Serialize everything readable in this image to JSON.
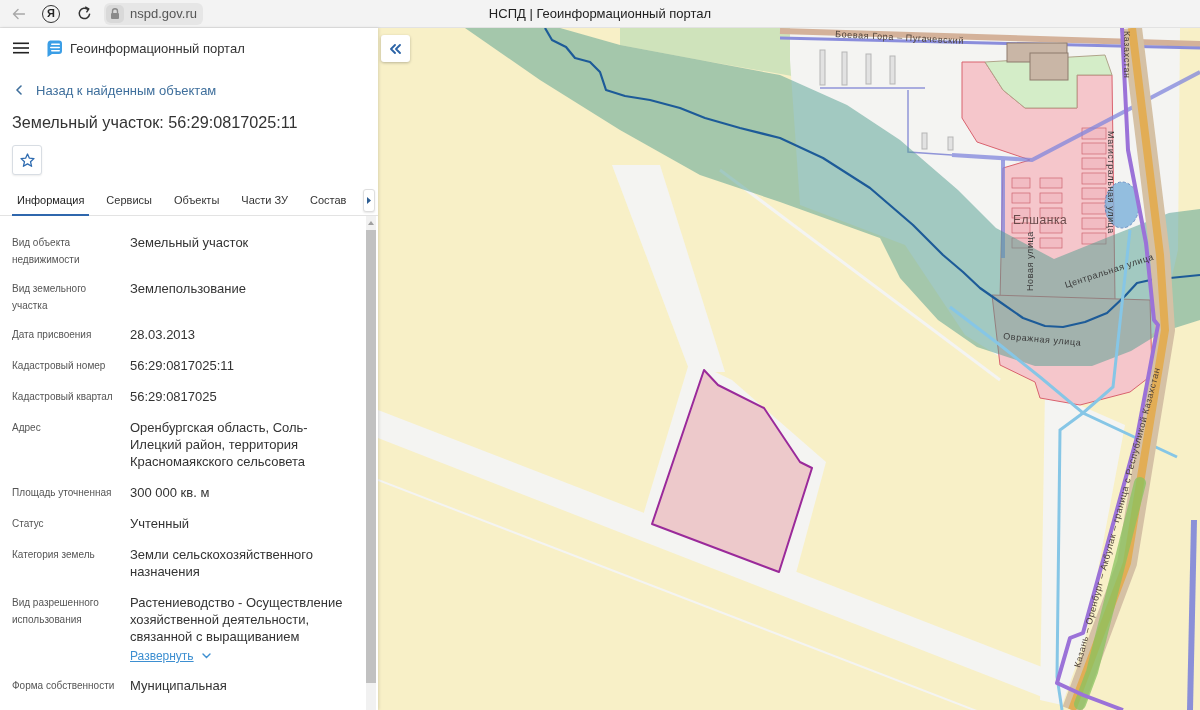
{
  "browser": {
    "brand_glyph": "Я",
    "url": "nspd.gov.ru",
    "page_title": "НСПД | Геоинформационный портал"
  },
  "app_header": {
    "title": "Геоинформационный портал"
  },
  "back_link": "Назад к найденным объектам",
  "object_title": "Земельный участок: 56:29:0817025:11",
  "tabs": [
    {
      "label": "Информация",
      "selected": true
    },
    {
      "label": "Сервисы",
      "selected": false
    },
    {
      "label": "Объекты",
      "selected": false
    },
    {
      "label": "Части ЗУ",
      "selected": false
    },
    {
      "label": "Состав",
      "selected": false
    }
  ],
  "details": [
    {
      "label": "Вид объекта недвижимости",
      "value": "Земельный участок"
    },
    {
      "label": "Вид земельного участка",
      "value": "Землепользование"
    },
    {
      "label": "Дата присвоения",
      "value": "28.03.2013"
    },
    {
      "label": "Кадастровый номер",
      "value": "56:29:0817025:11"
    },
    {
      "label": "Кадастровый квартал",
      "value": "56:29:0817025"
    },
    {
      "label": "Адрес",
      "value": "Оренбургская область, Соль-Илецкий район, территория Красномаякского сельсовета"
    },
    {
      "label": "Площадь уточненная",
      "value": "300 000 кв. м"
    },
    {
      "label": "Статус",
      "value": "Учтенный"
    },
    {
      "label": "Категория земель",
      "value": "Земли сельскохозяйственного назначения"
    },
    {
      "label": "Вид разрешенного использования",
      "value": "Растениеводство - Осуществление хозяйственной деятельности, связанной с выращиванием",
      "expand_link": "Развернуть"
    },
    {
      "label": "Форма собственности",
      "value": "Муниципальная"
    }
  ],
  "map": {
    "labels": [
      {
        "text": "Боевая Гора – Пугачевский",
        "kind": "road"
      },
      {
        "text": "Казахстан",
        "kind": "road"
      },
      {
        "text": "Магистральная улица",
        "kind": "street"
      },
      {
        "text": "Елшанка",
        "kind": "settlement"
      },
      {
        "text": "Новая улица",
        "kind": "street"
      },
      {
        "text": "Центральная улица",
        "kind": "street"
      },
      {
        "text": "Овражная улица",
        "kind": "street"
      },
      {
        "text": "Казань – Оренбург – Акбулак – граница с Республикой Казахстан",
        "kind": "road"
      }
    ]
  }
}
